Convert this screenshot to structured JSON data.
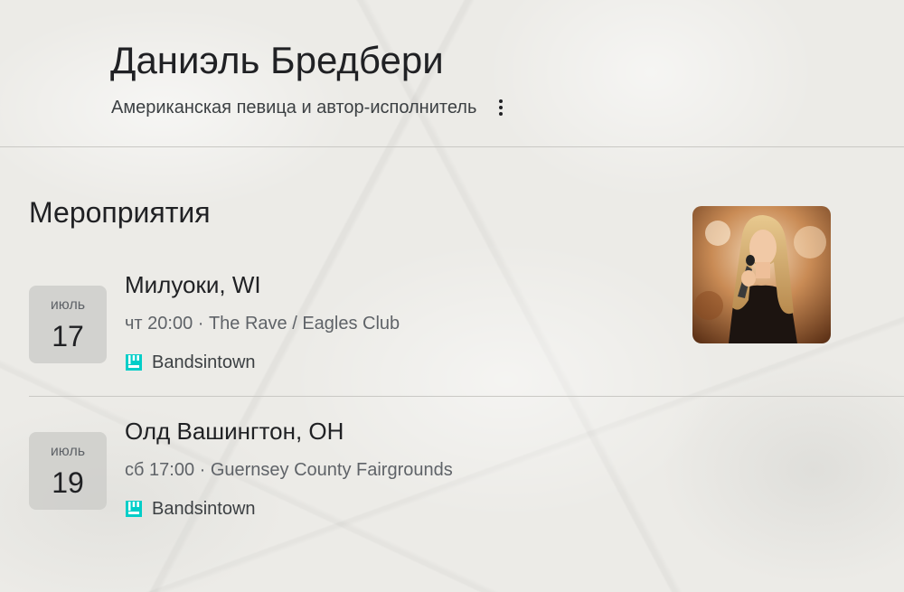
{
  "header": {
    "title": "Даниэль Бредбери",
    "subtitle": "Американская певица и автор-исполнитель",
    "more_icon": "more-vertical-icon"
  },
  "events_section": {
    "title": "Мероприятия",
    "photo_icon": "artist-photo",
    "items": [
      {
        "month": "июль",
        "day": "17",
        "city": "Милуоки, WI",
        "meta": "чт 20:00 · The Rave / Eagles Club",
        "source": "Bandsintown",
        "source_icon": "bandsintown-icon"
      },
      {
        "month": "июль",
        "day": "19",
        "city": "Олд Вашингтон, OH",
        "meta": "сб 17:00 · Guernsey County Fairgrounds",
        "source": "Bandsintown",
        "source_icon": "bandsintown-icon"
      }
    ]
  },
  "colors": {
    "accent_bandsintown": "#00cec8",
    "text_primary": "#202124",
    "text_secondary": "#5f6368"
  }
}
